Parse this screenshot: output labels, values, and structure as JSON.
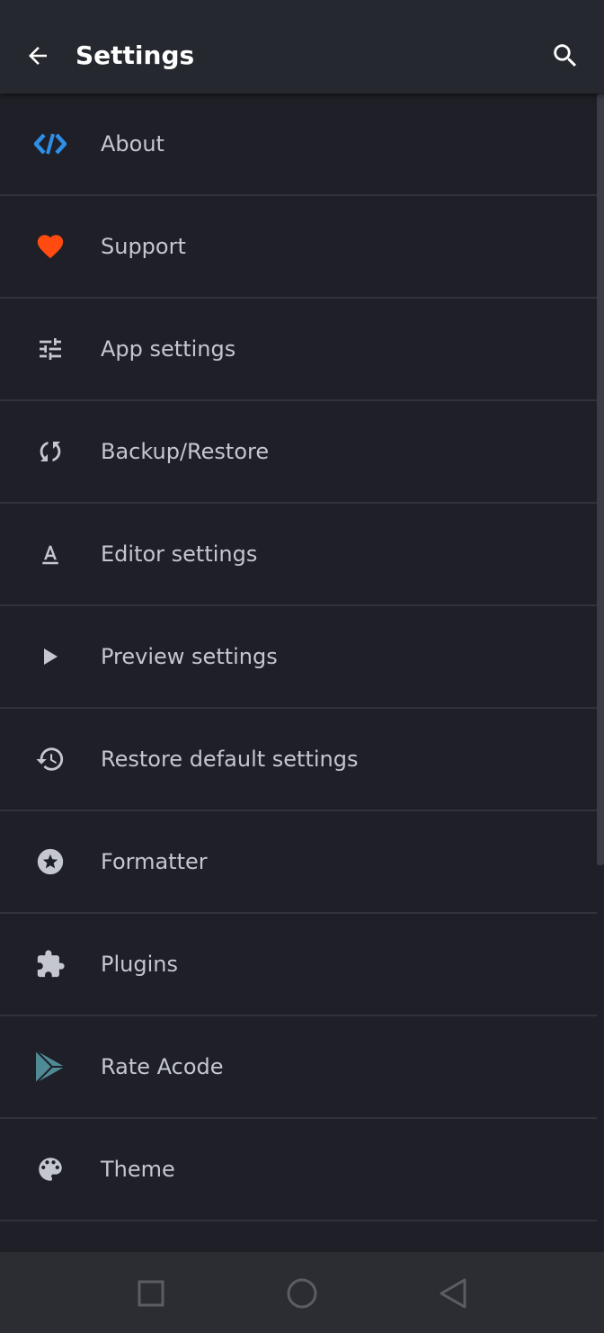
{
  "header": {
    "title": "Settings",
    "back_icon": "arrow-back-icon",
    "search_icon": "search-icon"
  },
  "items": [
    {
      "label": "About",
      "icon": "code-icon",
      "color": "#2f8ee6"
    },
    {
      "label": "Support",
      "icon": "heart-icon",
      "color": "#ff4a10"
    },
    {
      "label": "App settings",
      "icon": "tune-icon",
      "color": "#c4c8ce"
    },
    {
      "label": "Backup/Restore",
      "icon": "sync-icon",
      "color": "#c4c8ce"
    },
    {
      "label": "Editor settings",
      "icon": "text-format-icon",
      "color": "#c4c8ce"
    },
    {
      "label": "Preview settings",
      "icon": "play-icon",
      "color": "#c4c8ce"
    },
    {
      "label": "Restore default settings",
      "icon": "history-icon",
      "color": "#c4c8ce"
    },
    {
      "label": "Formatter",
      "icon": "star-circle-icon",
      "color": "#c4c8ce"
    },
    {
      "label": "Plugins",
      "icon": "puzzle-icon",
      "color": "#c4c8ce"
    },
    {
      "label": "Rate Acode",
      "icon": "play-store-icon",
      "color": "#4f8a95"
    },
    {
      "label": "Theme",
      "icon": "palette-icon",
      "color": "#c4c8ce"
    }
  ],
  "navbar": {
    "recents_icon": "square-icon",
    "home_icon": "circle-icon",
    "back_icon": "triangle-back-icon"
  }
}
